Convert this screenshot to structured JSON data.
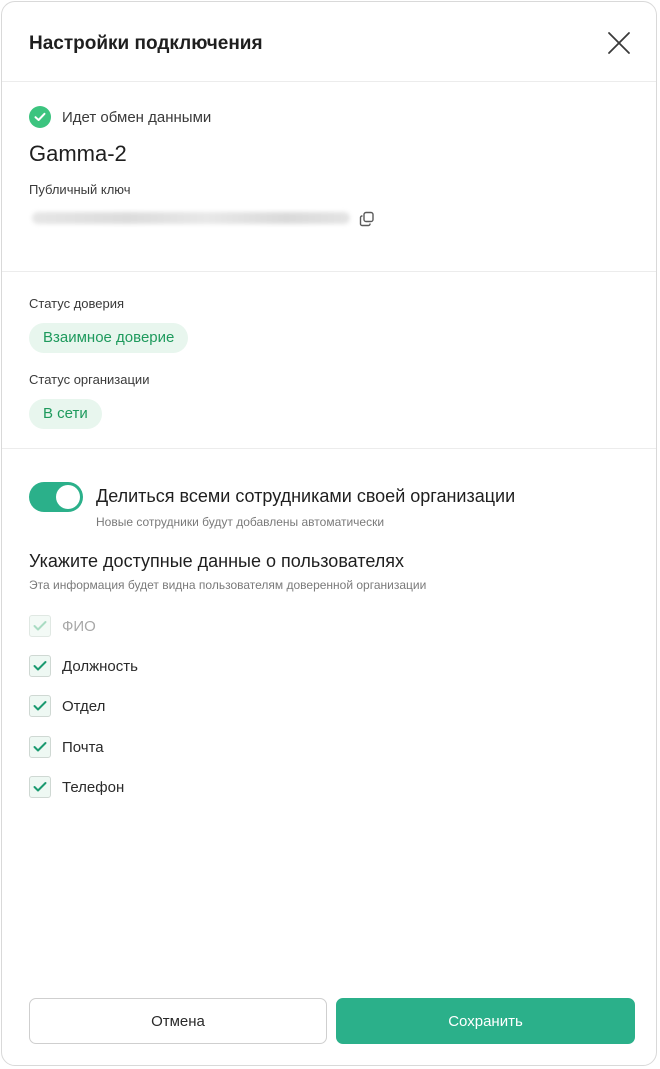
{
  "dialog": {
    "title": "Настройки подключения",
    "close_icon": "close-icon"
  },
  "connection": {
    "status_text": "Идет обмен данными",
    "status_icon": "check-circle-icon",
    "org_name": "Gamma-2",
    "public_key_label": "Публичный ключ",
    "copy_icon": "copy-icon"
  },
  "trust": {
    "label": "Статус доверия",
    "value": "Взаимное доверие"
  },
  "org_status": {
    "label": "Статус организации",
    "value": "В сети"
  },
  "sharing": {
    "toggle_on": true,
    "title": "Делиться всеми сотрудниками своей организации",
    "subtitle": "Новые сотрудники будут добавлены автоматически"
  },
  "user_data": {
    "title": "Укажите доступные данные о пользователях",
    "subtitle": "Эта информация будет видна пользователям доверенной организации",
    "fields": [
      {
        "label": "ФИО",
        "checked": true,
        "disabled": true
      },
      {
        "label": "Должность",
        "checked": true,
        "disabled": false
      },
      {
        "label": "Отдел",
        "checked": true,
        "disabled": false
      },
      {
        "label": "Почта",
        "checked": true,
        "disabled": false
      },
      {
        "label": "Телефон",
        "checked": true,
        "disabled": false
      }
    ]
  },
  "actions": {
    "cancel_label": "Отмена",
    "save_label": "Сохранить"
  },
  "colors": {
    "accent": "#2bb08a",
    "success_icon": "#3cc47f",
    "badge_bg": "#e8f6ee",
    "badge_text": "#1e9a5d"
  }
}
